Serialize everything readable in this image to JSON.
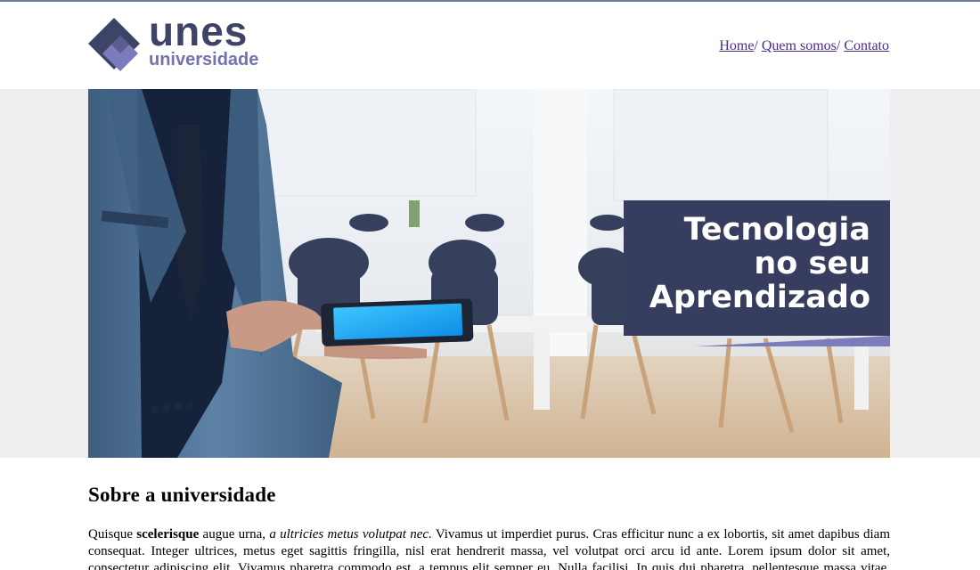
{
  "header": {
    "logo": {
      "name": "unes",
      "subtitle": "universidade"
    },
    "nav": [
      {
        "label": "Home"
      },
      {
        "label": "Quem somos"
      },
      {
        "label": "Contato"
      }
    ],
    "separator": "/ "
  },
  "hero": {
    "title_lines": [
      "Tecnologia",
      "no seu",
      "Aprendizado"
    ]
  },
  "about": {
    "heading": "Sobre a universidade",
    "p_start": "Quisque ",
    "p_bold": "scelerisque",
    "p_mid": " augue urna, ",
    "p_italic": "a ultricies metus volutpat nec.",
    "p_rest": " Vivamus ut imperdiet purus. Cras efficitur nunc a ex lobortis, sit amet dapibus diam consequat. Integer ultrices, metus eget sagittis fringilla, nisl erat hendrerit massa, vel volutpat orci arcu id ante. Lorem ipsum dolor sit amet, consectetur adipiscing elit. Vivamus pharetra commodo est, a tempus elit semper eu. Nulla facilisi. In quis dui pharetra, pellentesque massa vitae, ornare mauris."
  },
  "colors": {
    "brand_dark": "#363d5e",
    "brand_light": "#7272b0",
    "link": "#4b2c88"
  }
}
